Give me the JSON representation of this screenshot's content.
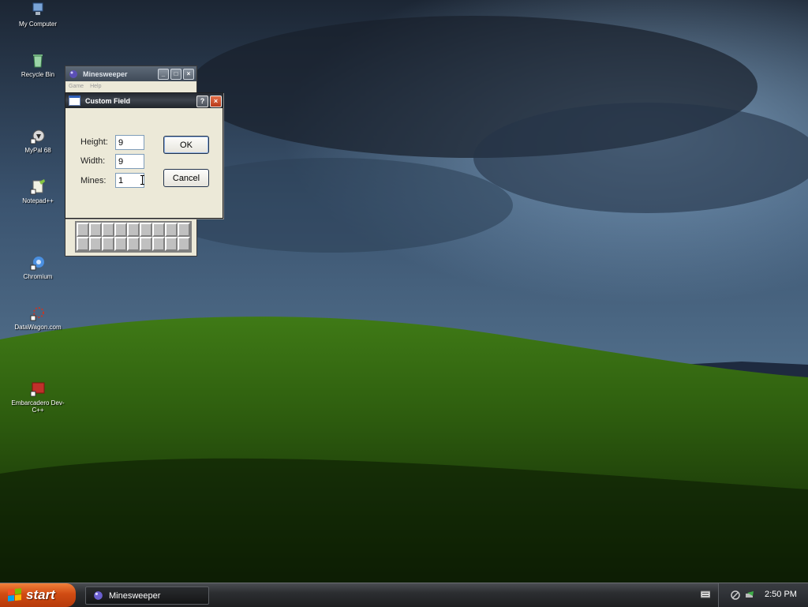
{
  "desktop": {
    "icons": [
      {
        "label": "My Computer"
      },
      {
        "label": "Recycle Bin"
      },
      {
        "label": "MyPal 68"
      },
      {
        "label": "Notepad++"
      },
      {
        "label": "Chromium"
      },
      {
        "label": "DataWagon.com"
      },
      {
        "label": "Embarcadero Dev-C++"
      }
    ]
  },
  "minesweeper": {
    "title": "Minesweeper",
    "menu": [
      "Game",
      "Help"
    ]
  },
  "dialog": {
    "title": "Custom Field",
    "help_icon": "question-icon",
    "close_icon": "close-icon",
    "height_label": "Height:",
    "height_value": "9",
    "width_label": "Width:",
    "width_value": "9",
    "mines_label": "Mines:",
    "mines_value": "1",
    "ok_label": "OK",
    "cancel_label": "Cancel"
  },
  "taskbar": {
    "start_label": "start",
    "task_button_label": "Minesweeper",
    "clock": "2:50 PM"
  },
  "colors": {
    "accent_start": "#d04b13",
    "title_bar": "#2a2f36",
    "dialog_face": "#ece9d8"
  }
}
